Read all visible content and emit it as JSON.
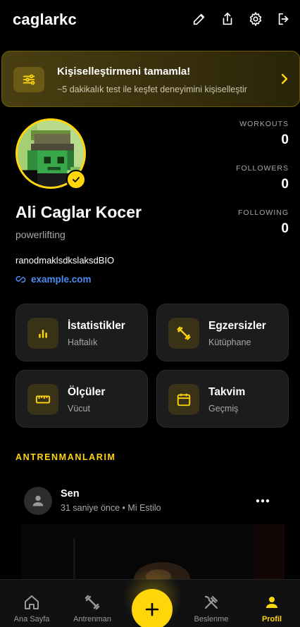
{
  "header": {
    "username": "caglarkc"
  },
  "banner": {
    "title": "Kişiselleştirmeni tamamla!",
    "subtitle": "~5 dakikalık test ile keşfet deneyimini kişiselleştir"
  },
  "profile": {
    "name": "Ali Caglar Kocer",
    "tagline": "powerlifting",
    "bio": "ranodmaklsdkslaksdBIO",
    "link": "example.com"
  },
  "stats": [
    {
      "label": "WORKOUTS",
      "value": "0"
    },
    {
      "label": "FOLLOWERS",
      "value": "0"
    },
    {
      "label": "FOLLOWING",
      "value": "0"
    }
  ],
  "cards": [
    {
      "title": "İstatistikler",
      "subtitle": "Haftalık",
      "icon": "bar-chart-icon"
    },
    {
      "title": "Egzersizler",
      "subtitle": "Kütüphane",
      "icon": "dumbbell-icon"
    },
    {
      "title": "Ölçüler",
      "subtitle": "Vücut",
      "icon": "ruler-icon"
    },
    {
      "title": "Takvim",
      "subtitle": "Geçmiş",
      "icon": "calendar-icon"
    }
  ],
  "section_title": "ANTRENMANLARIM",
  "post": {
    "author": "Sen",
    "meta": "31 saniye önce • Mi Estilo"
  },
  "nav": [
    {
      "label": "Ana Sayfa",
      "icon": "home-icon"
    },
    {
      "label": "Antrenman",
      "icon": "dumbbell-icon"
    },
    {
      "label": "Beslenme",
      "icon": "utensils-icon"
    },
    {
      "label": "Profil",
      "icon": "person-icon",
      "active": true
    }
  ],
  "colors": {
    "accent": "#ffd60a",
    "link": "#4d8cf5",
    "card": "#1c1c1e",
    "background": "#000000"
  }
}
